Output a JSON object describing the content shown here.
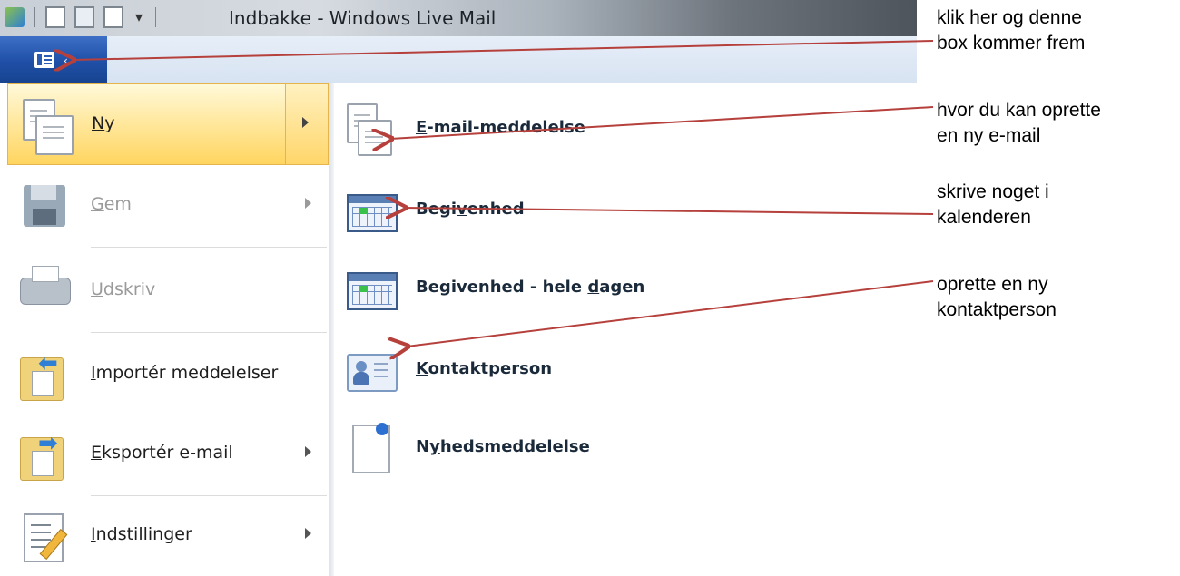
{
  "window": {
    "title": "Indbakke - Windows Live Mail"
  },
  "menu": {
    "left_items": [
      {
        "label_pre": "",
        "label_ul": "N",
        "label_post": "y",
        "state": "active",
        "has_submenu": true,
        "icon": "new-message-icon"
      },
      {
        "label_pre": "",
        "label_ul": "G",
        "label_post": "em",
        "state": "disabled",
        "has_submenu": true,
        "icon": "floppy-disk-icon"
      },
      {
        "label_pre": "",
        "label_ul": "U",
        "label_post": "dskriv",
        "state": "disabled",
        "has_submenu": false,
        "icon": "printer-icon"
      },
      {
        "label_pre": "",
        "label_ul": "I",
        "label_post": "mportér meddelelser",
        "state": "enabled",
        "has_submenu": false,
        "icon": "import-folder-icon"
      },
      {
        "label_pre": "",
        "label_ul": "E",
        "label_post": "ksportér e-mail",
        "state": "enabled",
        "has_submenu": true,
        "icon": "export-folder-icon"
      },
      {
        "label_pre": "",
        "label_ul": "I",
        "label_post": "ndstillinger",
        "state": "enabled",
        "has_submenu": true,
        "icon": "settings-checklist-icon"
      }
    ],
    "right_items": [
      {
        "label_pre": "",
        "label_ul": "E",
        "label_post": "-mail-meddelelse",
        "icon": "email-document-icon"
      },
      {
        "label_pre": "Begi",
        "label_ul": "v",
        "label_post": "enhed",
        "icon": "calendar-icon"
      },
      {
        "label_pre": "Begivenhed - hele ",
        "label_ul": "d",
        "label_post": "agen",
        "icon": "calendar-icon"
      },
      {
        "label_pre": "",
        "label_ul": "K",
        "label_post": "ontaktperson",
        "icon": "contact-card-icon"
      },
      {
        "label_pre": "N",
        "label_ul": "y",
        "label_post": "hedsmeddelelse",
        "icon": "news-pin-icon"
      }
    ]
  },
  "annotations": [
    {
      "line1": "klik her og denne",
      "line2": "box kommer frem"
    },
    {
      "line1": "hvor du kan oprette",
      "line2": "en ny e-mail"
    },
    {
      "line1": "skrive noget i",
      "line2": "kalenderen"
    },
    {
      "line1": "oprette en ny",
      "line2": "kontaktperson"
    }
  ],
  "colors": {
    "app_button": "#1f4fa6",
    "highlight": "#ffd560",
    "arrow": "#b5403c"
  }
}
